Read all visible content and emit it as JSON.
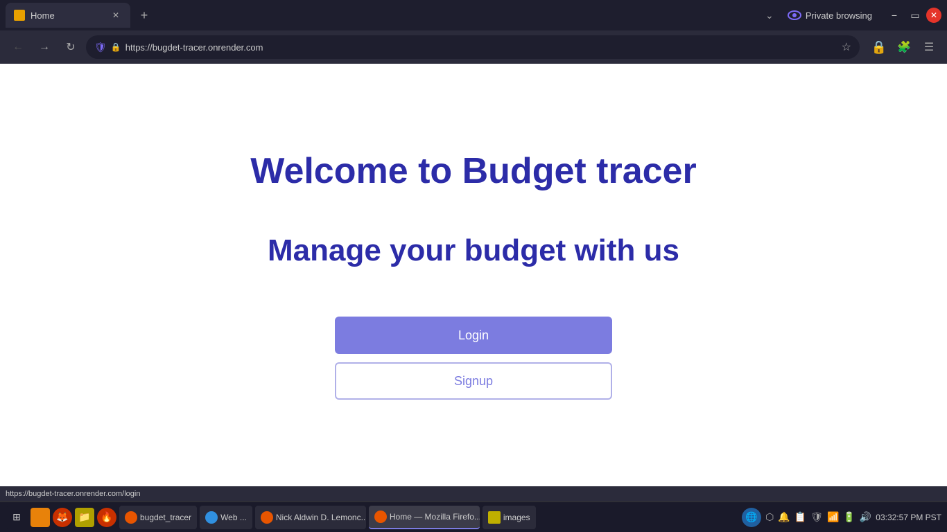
{
  "browser": {
    "tab": {
      "title": "Home",
      "favicon_color": "#e8a000"
    },
    "new_tab_label": "+",
    "private_browsing_label": "Private browsing",
    "address": "https://bugdet-tracer.onrender.com",
    "window_controls": {
      "minimize": "−",
      "maximize": "▭",
      "close": "✕"
    }
  },
  "page": {
    "welcome_title": "Welcome to Budget tracer",
    "subtitle": "Manage your budget with us",
    "login_button": "Login",
    "signup_button": "Signup"
  },
  "status_bar": {
    "url": "https://bugdet-tracer.onrender.com/login"
  },
  "taskbar": {
    "apps": [
      {
        "name": "bugdet_tracer",
        "icon_color": "#e85500"
      },
      {
        "name": "Web ...",
        "icon_color": "#3090e0"
      },
      {
        "name": "Nick Aldwin D. Lemonc...",
        "icon_color": "#e85500"
      },
      {
        "name": "Home — Mozilla Firefo...",
        "icon_color": "#e85500",
        "active": true
      },
      {
        "name": "images",
        "icon_color": "#c0c0c0"
      }
    ],
    "time": "03:32:57 PM PST"
  }
}
